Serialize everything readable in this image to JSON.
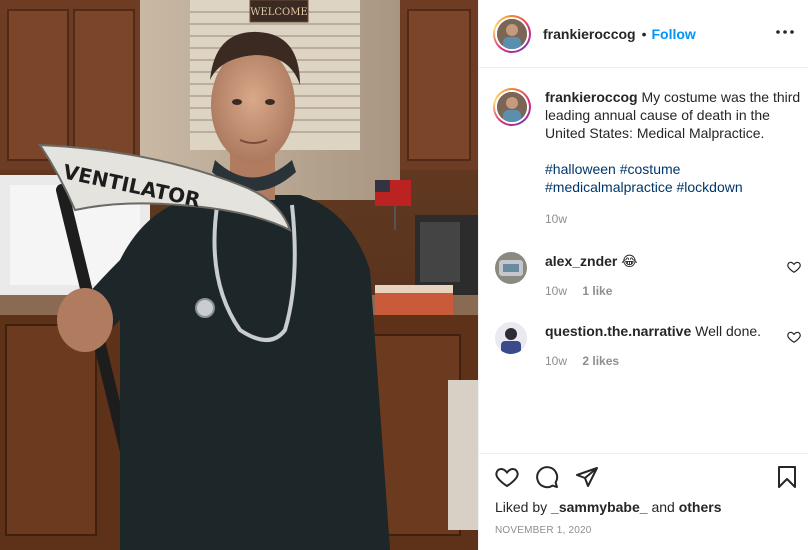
{
  "post": {
    "username": "frankieroccog",
    "follow_label": "Follow",
    "separator": "•",
    "caption": {
      "username": "frankieroccog",
      "text": "My costume was the third leading annual cause of death in the United States: Medical Malpractice.",
      "hashtags": [
        "#halloween",
        "#costume",
        "#medicalmalpractice",
        "#lockdown"
      ],
      "time": "10w"
    },
    "comments": [
      {
        "username": "alex_znder",
        "text": "😂",
        "time": "10w",
        "likes": "1 like"
      },
      {
        "username": "question.the.narrative",
        "text": "Well done.",
        "time": "10w",
        "likes": "2 likes"
      }
    ],
    "liked_by": {
      "prefix": "Liked by",
      "user": "_sammybabe_",
      "middle": "and",
      "others": "others"
    },
    "date": "NOVEMBER 1, 2020"
  },
  "photo": {
    "sign_welcome": "WELCOME",
    "sign_scythe": "VENTILATOR"
  },
  "colors": {
    "accent": "#0095f6",
    "hashtag": "#00376b",
    "muted": "#8e8e8e"
  },
  "icons": [
    "more-icon",
    "heart-icon",
    "comment-icon",
    "share-icon",
    "bookmark-icon"
  ]
}
